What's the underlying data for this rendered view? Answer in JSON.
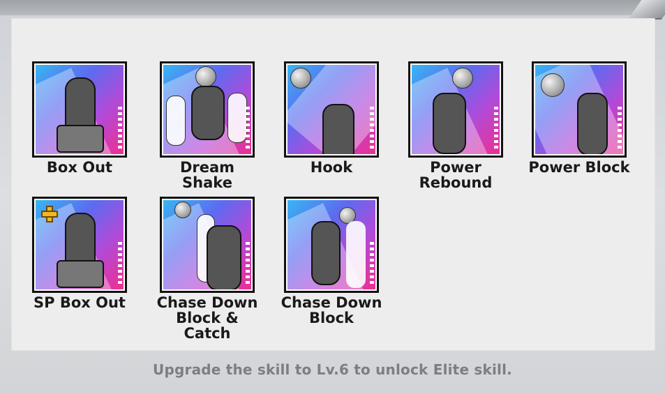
{
  "skills": [
    {
      "label": "Box Out",
      "icon": "box-out-icon",
      "plus_badge": false
    },
    {
      "label": "Dream Shake",
      "icon": "dream-shake-icon",
      "plus_badge": false
    },
    {
      "label": "Hook",
      "icon": "hook-icon",
      "plus_badge": false
    },
    {
      "label": "Power\nRebound",
      "icon": "power-rebound-icon",
      "plus_badge": false
    },
    {
      "label": "Power Block",
      "icon": "power-block-icon",
      "plus_badge": false
    },
    {
      "label": "SP Box Out",
      "icon": "sp-box-out-icon",
      "plus_badge": true
    },
    {
      "label": "Chase Down\nBlock & Catch",
      "icon": "chase-down-block-catch-icon",
      "plus_badge": false
    },
    {
      "label": "Chase Down\nBlock",
      "icon": "chase-down-block-icon",
      "plus_badge": false
    }
  ],
  "footer": {
    "hint": "Upgrade the skill to Lv.6 to unlock Elite skill."
  },
  "colors": {
    "card_gradient_start": "#37b7f2",
    "card_gradient_end": "#ee2f90",
    "plus_badge": "#f2b820",
    "hint_text": "#7b7e83"
  }
}
